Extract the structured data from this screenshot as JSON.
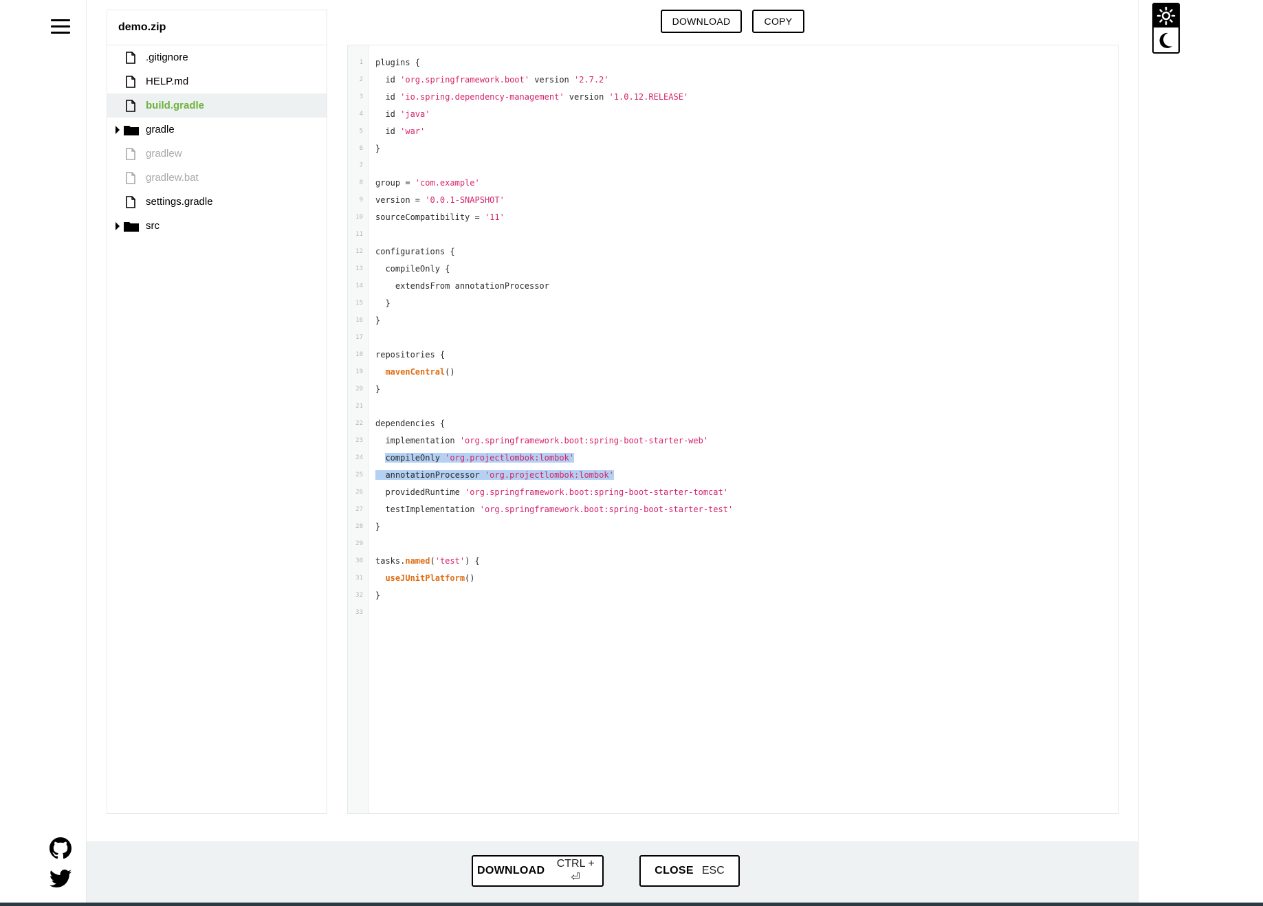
{
  "explorer": {
    "title": "demo.zip",
    "items": [
      {
        "label": ".gitignore",
        "type": "file"
      },
      {
        "label": "HELP.md",
        "type": "file"
      },
      {
        "label": "build.gradle",
        "type": "file",
        "selected": true
      },
      {
        "label": "gradle",
        "type": "folder"
      },
      {
        "label": "gradlew",
        "type": "file",
        "disabled": true
      },
      {
        "label": "gradlew.bat",
        "type": "file",
        "disabled": true
      },
      {
        "label": "settings.gradle",
        "type": "file"
      },
      {
        "label": "src",
        "type": "folder"
      }
    ]
  },
  "toolbar": {
    "download_label": "DOWNLOAD",
    "copy_label": "COPY"
  },
  "footer": {
    "download_label": "DOWNLOAD",
    "download_shortcut": "CTRL + ⏎",
    "close_label": "CLOSE",
    "close_shortcut": "ESC"
  },
  "code": {
    "line_numbers": [
      "1",
      "2",
      "3",
      "4",
      "5",
      "6",
      "7",
      "8",
      "9",
      "10",
      "11",
      "12",
      "13",
      "14",
      "15",
      "16",
      "17",
      "18",
      "19",
      "20",
      "21",
      "22",
      "23",
      "24",
      "25",
      "26",
      "27",
      "28",
      "29",
      "30",
      "31",
      "32",
      "33"
    ],
    "lines": [
      [
        {
          "t": "plugins {"
        }
      ],
      [
        {
          "t": "  id "
        },
        {
          "t": "'org.springframework.boot'",
          "c": "str"
        },
        {
          "t": " version "
        },
        {
          "t": "'2.7.2'",
          "c": "str"
        }
      ],
      [
        {
          "t": "  id "
        },
        {
          "t": "'io.spring.dependency-management'",
          "c": "str"
        },
        {
          "t": " version "
        },
        {
          "t": "'1.0.12.RELEASE'",
          "c": "str"
        }
      ],
      [
        {
          "t": "  id "
        },
        {
          "t": "'java'",
          "c": "str"
        }
      ],
      [
        {
          "t": "  id "
        },
        {
          "t": "'war'",
          "c": "str"
        }
      ],
      [
        {
          "t": "}"
        }
      ],
      [],
      [
        {
          "t": "group = "
        },
        {
          "t": "'com.example'",
          "c": "str"
        }
      ],
      [
        {
          "t": "version = "
        },
        {
          "t": "'0.0.1-SNAPSHOT'",
          "c": "str"
        }
      ],
      [
        {
          "t": "sourceCompatibility = "
        },
        {
          "t": "'11'",
          "c": "str"
        }
      ],
      [],
      [
        {
          "t": "configurations {"
        }
      ],
      [
        {
          "t": "  compileOnly {"
        }
      ],
      [
        {
          "t": "    extendsFrom annotationProcessor"
        }
      ],
      [
        {
          "t": "  }"
        }
      ],
      [
        {
          "t": "}"
        }
      ],
      [],
      [
        {
          "t": "repositories {"
        }
      ],
      [
        {
          "t": "  "
        },
        {
          "t": "mavenCentral",
          "c": "fn"
        },
        {
          "t": "()"
        }
      ],
      [
        {
          "t": "}"
        }
      ],
      [],
      [
        {
          "t": "dependencies {"
        }
      ],
      [
        {
          "t": "  implementation "
        },
        {
          "t": "'org.springframework.boot:spring-boot-starter-web'",
          "c": "str"
        }
      ],
      [
        {
          "t": "  "
        },
        {
          "t": "compileOnly ",
          "sel": true
        },
        {
          "t": "'org.projectlombok:lombok'",
          "c": "str",
          "sel": true
        }
      ],
      [
        {
          "t": "  annotationProcessor ",
          "sel": true
        },
        {
          "t": "'org.projectlombok:lombok'",
          "c": "str",
          "sel": true
        }
      ],
      [
        {
          "t": "  providedRuntime "
        },
        {
          "t": "'org.springframework.boot:spring-boot-starter-tomcat'",
          "c": "str"
        }
      ],
      [
        {
          "t": "  testImplementation "
        },
        {
          "t": "'org.springframework.boot:spring-boot-starter-test'",
          "c": "str"
        }
      ],
      [
        {
          "t": "}"
        }
      ],
      [],
      [
        {
          "t": "tasks."
        },
        {
          "t": "named",
          "c": "fn"
        },
        {
          "t": "("
        },
        {
          "t": "'test'",
          "c": "str"
        },
        {
          "t": ") {"
        }
      ],
      [
        {
          "t": "  "
        },
        {
          "t": "useJUnitPlatform",
          "c": "fn"
        },
        {
          "t": "()"
        }
      ],
      [
        {
          "t": "}"
        }
      ],
      []
    ]
  },
  "icons": {
    "menu": "hamburger-menu-icon",
    "github": "github-icon",
    "twitter": "twitter-icon",
    "theme_light": "sun-icon",
    "theme_dark": "moon-icon",
    "file": "file-icon",
    "folder": "folder-icon"
  },
  "colors": {
    "selected_file": "#6db33f",
    "string": "#d6246a",
    "function": "#e06f16",
    "selection": "#b4d0f3",
    "footer_bg": "#eef2f2"
  }
}
